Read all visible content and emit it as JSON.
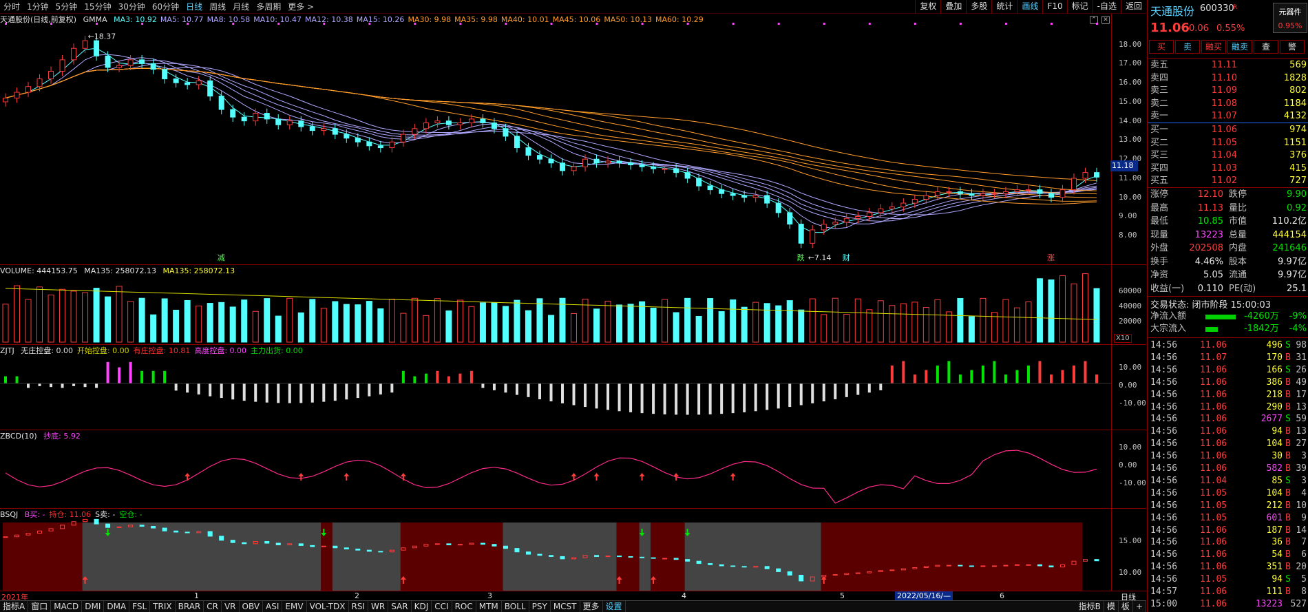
{
  "toolbar": {
    "timeframes": [
      "分时",
      "1分钟",
      "5分钟",
      "15分钟",
      "30分钟",
      "60分钟",
      "日线",
      "周线",
      "月线",
      "多周期",
      "更多 >"
    ],
    "active_timeframe": "日线",
    "right_buttons": [
      "复权",
      "叠加",
      "多股",
      "统计",
      "画线",
      "F10",
      "标记",
      "-自选",
      "返回"
    ]
  },
  "main_panel": {
    "stock_label": "天通股份(日线,前复权)",
    "indicator": "GMMA",
    "ma_values": [
      {
        "label": "MA3: 10.92",
        "color": "#54ffff"
      },
      {
        "label": "MA5: 10.77",
        "color": "#b0a8ff"
      },
      {
        "label": "MA8: 10.58",
        "color": "#b0a8ff"
      },
      {
        "label": "MA10: 10.47",
        "color": "#b0a8ff"
      },
      {
        "label": "MA12: 10.38",
        "color": "#b0a8ff"
      },
      {
        "label": "MA15: 10.26",
        "color": "#b0a8ff"
      },
      {
        "label": "MA30: 9.98",
        "color": "#ff9c2a"
      },
      {
        "label": "MA35: 9.98",
        "color": "#ff9c2a"
      },
      {
        "label": "MA40: 10.01",
        "color": "#ff9c2a"
      },
      {
        "label": "MA45: 10.06",
        "color": "#ff9c2a"
      },
      {
        "label": "MA50: 10.13",
        "color": "#ff9c2a"
      },
      {
        "label": "MA60: 10.29",
        "color": "#ff9c2a"
      }
    ],
    "y_labels": [
      "18.00",
      "17.00",
      "16.00",
      "15.00",
      "14.00",
      "13.00",
      "12.00",
      "11.00",
      "10.00",
      "9.00",
      "8.00"
    ],
    "current_price_tag": "11.18",
    "high_annotation": "18.37",
    "low_annotation": "7.14",
    "markers": [
      {
        "text": "减",
        "color": "#54ff54"
      },
      {
        "text": "跌",
        "color": "#54ff54"
      },
      {
        "text": "财",
        "color": "#54ffff"
      },
      {
        "text": "涨",
        "color": "#ff5050"
      }
    ]
  },
  "volume_panel": {
    "title": "VOLUME: 444153.75",
    "ma1": "MA135: 258072.13",
    "ma2": "MA135: 258072.13",
    "y_labels": [
      "60000",
      "40000",
      "20000"
    ],
    "unit": "X10"
  },
  "zjtj_panel": {
    "title": "ZJTJ",
    "items": [
      {
        "label": "无庄控盘: 0.00",
        "color": "#e0e0e0"
      },
      {
        "label": "开始控盘: 0.00",
        "color": "#d0d000"
      },
      {
        "label": "有庄控盘: 10.81",
        "color": "#ff3030"
      },
      {
        "label": "高度控盘: 0.00",
        "color": "#ff44ff"
      },
      {
        "label": "主力出货: 0.00",
        "color": "#00e600"
      }
    ],
    "y_labels": [
      "10.00",
      "0.00",
      "-10.00"
    ]
  },
  "zbcd_panel": {
    "title": "ZBCD(10)",
    "item": "抄底: 5.92",
    "y_labels": [
      "10.00",
      "0.00",
      "-10.00"
    ]
  },
  "bsqj_panel": {
    "title": "BSQJ",
    "items": [
      {
        "label": "B买: -",
        "color": "#ff44ff"
      },
      {
        "label": "持仓: 11.06",
        "color": "#ff3030"
      },
      {
        "label": "S卖: -",
        "color": "#e0e0e0"
      },
      {
        "label": "空仓: -",
        "color": "#00e600"
      }
    ],
    "y_labels": [
      "15.00",
      "10.00"
    ]
  },
  "date_axis": {
    "labels": [
      "2021年",
      "1",
      "2",
      "3",
      "4",
      "5",
      "6"
    ],
    "highlight": "2022/05/16/—",
    "period": "日线"
  },
  "bottom_tabs": [
    "指标A",
    "窗口",
    "MACD",
    "DMI",
    "DMA",
    "FSL",
    "TRIX",
    "BRAR",
    "CR",
    "VR",
    "OBV",
    "ASI",
    "EMV",
    "VOL-TDX",
    "RSI",
    "WR",
    "SAR",
    "KDJ",
    "CCI",
    "ROC",
    "MTM",
    "BOLL",
    "PSY",
    "MCST",
    "更多",
    "设置"
  ],
  "bottom_right_tabs": [
    "指标B",
    "模",
    "板",
    "+"
  ],
  "quote": {
    "name": "天通股份",
    "code": "600330",
    "tag": "R",
    "corner_label": "元器件",
    "corner_value": "0.95%",
    "price": "11.06",
    "change": "0.06",
    "change_pct": "0.55%",
    "buttons": [
      "买",
      "卖",
      "融买",
      "融卖",
      "查",
      "警"
    ],
    "asks": [
      {
        "label": "卖五",
        "price": "11.11",
        "vol": "569"
      },
      {
        "label": "卖四",
        "price": "11.10",
        "vol": "1828"
      },
      {
        "label": "卖三",
        "price": "11.09",
        "vol": "802"
      },
      {
        "label": "卖二",
        "price": "11.08",
        "vol": "1184"
      },
      {
        "label": "卖一",
        "price": "11.07",
        "vol": "4132"
      }
    ],
    "bids": [
      {
        "label": "买一",
        "price": "11.06",
        "vol": "974"
      },
      {
        "label": "买二",
        "price": "11.05",
        "vol": "1151"
      },
      {
        "label": "买三",
        "price": "11.04",
        "vol": "376"
      },
      {
        "label": "买四",
        "price": "11.03",
        "vol": "415"
      },
      {
        "label": "买五",
        "price": "11.02",
        "vol": "727"
      }
    ],
    "stats": [
      {
        "l1": "涨停",
        "v1": "12.10",
        "c1": "#ff3c3c",
        "l2": "跌停",
        "v2": "9.90",
        "c2": "#00e600"
      },
      {
        "l1": "最高",
        "v1": "11.13",
        "c1": "#ff3c3c",
        "l2": "量比",
        "v2": "0.92",
        "c2": "#00e600"
      },
      {
        "l1": "最低",
        "v1": "10.85",
        "c1": "#00e600",
        "l2": "市值",
        "v2": "110.2亿",
        "c2": "#e8e8e8"
      },
      {
        "l1": "现量",
        "v1": "13223",
        "c1": "#ff44ff",
        "l2": "总量",
        "v2": "444154",
        "c2": "#ffff33"
      },
      {
        "l1": "外盘",
        "v1": "202508",
        "c1": "#ff3c3c",
        "l2": "内盘",
        "v2": "241646",
        "c2": "#00e600"
      },
      {
        "l1": "换手",
        "v1": "4.46%",
        "c1": "#e8e8e8",
        "l2": "股本",
        "v2": "9.97亿",
        "c2": "#e8e8e8"
      },
      {
        "l1": "净资",
        "v1": "5.05",
        "c1": "#e8e8e8",
        "l2": "流通",
        "v2": "9.97亿",
        "c2": "#e8e8e8"
      },
      {
        "l1": "收益(一)",
        "v1": "0.110",
        "c1": "#e8e8e8",
        "l2": "PE(动)",
        "v2": "25.1",
        "c2": "#e8e8e8"
      }
    ],
    "trade_status": "交易状态: 闭市阶段 15:00:03",
    "net_inflow": {
      "label": "净流入额",
      "value": "-4260万",
      "pct": "-9%",
      "bar": 0.85
    },
    "block_inflow": {
      "label": "大宗流入",
      "value": "-1842万",
      "pct": "-4%",
      "bar": 0.35
    },
    "ticks": [
      {
        "t": "14:56",
        "p": "11.06",
        "pc": "#ff3c3c",
        "q": "496",
        "qc": "#ffff33",
        "d": "S",
        "dc": "#00e600",
        "n": "98"
      },
      {
        "t": "14:56",
        "p": "11.07",
        "pc": "#ff3c3c",
        "q": "170",
        "qc": "#ffff33",
        "d": "B",
        "dc": "#ff3c3c",
        "n": "31"
      },
      {
        "t": "14:56",
        "p": "11.06",
        "pc": "#ff3c3c",
        "q": "166",
        "qc": "#ffff33",
        "d": "S",
        "dc": "#00e600",
        "n": "26"
      },
      {
        "t": "14:56",
        "p": "11.06",
        "pc": "#ff3c3c",
        "q": "386",
        "qc": "#ffff33",
        "d": "B",
        "dc": "#ff3c3c",
        "n": "49"
      },
      {
        "t": "14:56",
        "p": "11.06",
        "pc": "#ff3c3c",
        "q": "218",
        "qc": "#ffff33",
        "d": "B",
        "dc": "#ff3c3c",
        "n": "17"
      },
      {
        "t": "14:56",
        "p": "11.06",
        "pc": "#ff3c3c",
        "q": "290",
        "qc": "#ffff33",
        "d": "B",
        "dc": "#ff3c3c",
        "n": "13"
      },
      {
        "t": "14:56",
        "p": "11.06",
        "pc": "#ff3c3c",
        "q": "2677",
        "qc": "#ff44ff",
        "d": "S",
        "dc": "#00e600",
        "n": "59"
      },
      {
        "t": "14:56",
        "p": "11.06",
        "pc": "#ff3c3c",
        "q": "94",
        "qc": "#ffff33",
        "d": "B",
        "dc": "#ff3c3c",
        "n": "13"
      },
      {
        "t": "14:56",
        "p": "11.06",
        "pc": "#ff3c3c",
        "q": "104",
        "qc": "#ffff33",
        "d": "B",
        "dc": "#ff3c3c",
        "n": "27"
      },
      {
        "t": "14:56",
        "p": "11.06",
        "pc": "#ff3c3c",
        "q": "30",
        "qc": "#ffff33",
        "d": "B",
        "dc": "#ff3c3c",
        "n": "3"
      },
      {
        "t": "14:56",
        "p": "11.06",
        "pc": "#ff3c3c",
        "q": "582",
        "qc": "#ff44ff",
        "d": "B",
        "dc": "#ff3c3c",
        "n": "39"
      },
      {
        "t": "14:56",
        "p": "11.04",
        "pc": "#ff3c3c",
        "q": "85",
        "qc": "#ffff33",
        "d": "S",
        "dc": "#00e600",
        "n": "3"
      },
      {
        "t": "14:56",
        "p": "11.05",
        "pc": "#ff3c3c",
        "q": "104",
        "qc": "#ffff33",
        "d": "B",
        "dc": "#ff3c3c",
        "n": "4"
      },
      {
        "t": "14:56",
        "p": "11.05",
        "pc": "#ff3c3c",
        "q": "212",
        "qc": "#ffff33",
        "d": "B",
        "dc": "#ff3c3c",
        "n": "10"
      },
      {
        "t": "14:56",
        "p": "11.05",
        "pc": "#ff3c3c",
        "q": "601",
        "qc": "#ff44ff",
        "d": "B",
        "dc": "#ff3c3c",
        "n": "9"
      },
      {
        "t": "14:56",
        "p": "11.06",
        "pc": "#ff3c3c",
        "q": "187",
        "qc": "#ffff33",
        "d": "B",
        "dc": "#ff3c3c",
        "n": "14"
      },
      {
        "t": "14:56",
        "p": "11.06",
        "pc": "#ff3c3c",
        "q": "36",
        "qc": "#ffff33",
        "d": "B",
        "dc": "#ff3c3c",
        "n": "7"
      },
      {
        "t": "14:56",
        "p": "11.06",
        "pc": "#ff3c3c",
        "q": "54",
        "qc": "#ffff33",
        "d": "B",
        "dc": "#ff3c3c",
        "n": "6"
      },
      {
        "t": "14:56",
        "p": "11.06",
        "pc": "#ff3c3c",
        "q": "351",
        "qc": "#ffff33",
        "d": "B",
        "dc": "#ff3c3c",
        "n": "20"
      },
      {
        "t": "14:56",
        "p": "11.05",
        "pc": "#ff3c3c",
        "q": "94",
        "qc": "#ffff33",
        "d": "S",
        "dc": "#00e600",
        "n": "5"
      },
      {
        "t": "14:57",
        "p": "11.06",
        "pc": "#ff3c3c",
        "q": "111",
        "qc": "#ffff33",
        "d": "B",
        "dc": "#ff3c3c",
        "n": "8"
      },
      {
        "t": "15:00",
        "p": "11.06",
        "pc": "#ff3c3c",
        "q": "13223",
        "qc": "#ff44ff",
        "d": "",
        "dc": "#ff3c3c",
        "n": "527"
      }
    ]
  },
  "chart_data": {
    "type": "candlestick",
    "y_range": [
      7,
      18.6
    ],
    "close": [
      15.2,
      15.5,
      15.8,
      16.2,
      16.6,
      17.2,
      17.8,
      18.2,
      17.4,
      16.8,
      16.9,
      17.2,
      17.0,
      16.7,
      16.2,
      16.0,
      15.9,
      16.1,
      15.3,
      14.6,
      14.2,
      14.0,
      14.4,
      14.1,
      13.8,
      14.0,
      13.7,
      13.5,
      13.6,
      13.3,
      13.1,
      12.9,
      12.7,
      12.6,
      12.9,
      13.3,
      13.6,
      13.9,
      14.0,
      13.8,
      13.9,
      14.1,
      13.9,
      13.6,
      13.2,
      12.6,
      12.2,
      12.0,
      11.8,
      11.4,
      11.6,
      12.0,
      11.8,
      11.9,
      11.8,
      11.7,
      11.6,
      11.5,
      11.5,
      11.3,
      11.0,
      10.6,
      10.4,
      10.2,
      10.1,
      10.0,
      10.1,
      9.7,
      9.2,
      8.6,
      7.6,
      8.3,
      8.6,
      8.7,
      8.9,
      9.0,
      9.2,
      9.4,
      9.5,
      9.7,
      9.9,
      10.1,
      10.3,
      10.3,
      10.2,
      10.1,
      10.2,
      10.2,
      10.3,
      10.4,
      10.4,
      10.2,
      10.0,
      10.4,
      11.0,
      11.3,
      11.06
    ]
  }
}
